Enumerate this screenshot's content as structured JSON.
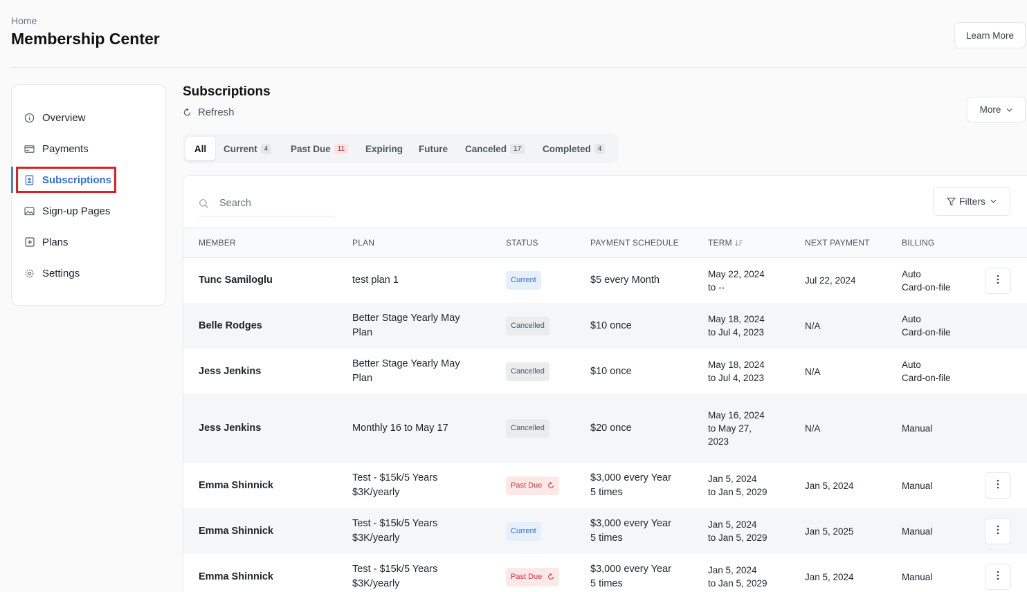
{
  "header": {
    "breadcrumb": "Home",
    "title": "Membership Center",
    "learn_more": "Learn More"
  },
  "sidebar": {
    "items": [
      {
        "label": "Overview",
        "icon": "info-icon"
      },
      {
        "label": "Payments",
        "icon": "card-icon"
      },
      {
        "label": "Subscriptions",
        "icon": "id-badge-icon",
        "active": true
      },
      {
        "label": "Sign-up Pages",
        "icon": "image-icon"
      },
      {
        "label": "Plans",
        "icon": "plus-square-icon"
      },
      {
        "label": "Settings",
        "icon": "gear-icon"
      }
    ]
  },
  "main": {
    "title": "Subscriptions",
    "refresh": "Refresh",
    "more": "More",
    "tabs": [
      {
        "label": "All",
        "count": null
      },
      {
        "label": "Current",
        "count": "4"
      },
      {
        "label": "Past Due",
        "count": "11"
      },
      {
        "label": "Expiring",
        "count": null
      },
      {
        "label": "Future",
        "count": null
      },
      {
        "label": "Canceled",
        "count": "17"
      },
      {
        "label": "Completed",
        "count": "4"
      }
    ],
    "search_placeholder": "Search",
    "filters": "Filters"
  },
  "table": {
    "columns": [
      "MEMBER",
      "PLAN",
      "STATUS",
      "PAYMENT SCHEDULE",
      "TERM",
      "NEXT PAYMENT",
      "BILLING"
    ],
    "rows": [
      {
        "member": "Tunc Samiloglu",
        "plan": [
          "test plan 1"
        ],
        "status": "Current",
        "schedule": [
          "$5 every Month"
        ],
        "term": [
          "May 22, 2024",
          "to --"
        ],
        "next": "Jul 22, 2024",
        "billing": [
          "Auto",
          "Card-on-file"
        ],
        "menu": true
      },
      {
        "member": "Belle Rodges",
        "plan": [
          "Better Stage Yearly May",
          "Plan"
        ],
        "status": "Cancelled",
        "schedule": [
          "$10 once"
        ],
        "term": [
          "May 18, 2024",
          "to Jul 4, 2023"
        ],
        "next": "N/A",
        "billing": [
          "Auto",
          "Card-on-file"
        ],
        "menu": false
      },
      {
        "member": "Jess Jenkins",
        "plan": [
          "Better Stage Yearly May",
          "Plan"
        ],
        "status": "Cancelled",
        "schedule": [
          "$10 once"
        ],
        "term": [
          "May 18, 2024",
          "to Jul 4, 2023"
        ],
        "next": "N/A",
        "billing": [
          "Auto",
          "Card-on-file"
        ],
        "menu": false
      },
      {
        "member": "Jess Jenkins",
        "plan": [
          "Monthly 16 to May 17"
        ],
        "status": "Cancelled",
        "schedule": [
          "$20 once"
        ],
        "term": [
          "May 16, 2024",
          "to May 27,",
          "2023"
        ],
        "next": "N/A",
        "billing": [
          "Manual"
        ],
        "menu": false
      },
      {
        "member": "Emma Shinnick",
        "plan": [
          "Test - $15k/5 Years",
          "$3K/yearly"
        ],
        "status": "Past Due",
        "schedule": [
          "$3,000 every Year",
          "5 times"
        ],
        "term": [
          "Jan 5, 2024",
          "to Jan 5, 2029"
        ],
        "next": "Jan 5, 2024",
        "billing": [
          "Manual"
        ],
        "menu": true
      },
      {
        "member": "Emma Shinnick",
        "plan": [
          "Test - $15k/5 Years",
          "$3K/yearly"
        ],
        "status": "Current",
        "schedule": [
          "$3,000 every Year",
          "5 times"
        ],
        "term": [
          "Jan 5, 2024",
          "to Jan 5, 2029"
        ],
        "next": "Jan 5, 2025",
        "billing": [
          "Manual"
        ],
        "menu": true
      },
      {
        "member": "Emma Shinnick",
        "plan": [
          "Test - $15k/5 Years",
          "$3K/yearly"
        ],
        "status": "Past Due",
        "schedule": [
          "$3,000 every Year",
          "5 times"
        ],
        "term": [
          "Jan 5, 2024",
          "to Jan 5, 2029"
        ],
        "next": "Jan 5, 2024",
        "billing": [
          "Manual"
        ],
        "menu": true
      }
    ]
  },
  "colors": {
    "accent": "#2f6fd4",
    "active_indicator": "#3b82f6",
    "highlight_box": "#e02020",
    "past_due": "#d0353a"
  }
}
